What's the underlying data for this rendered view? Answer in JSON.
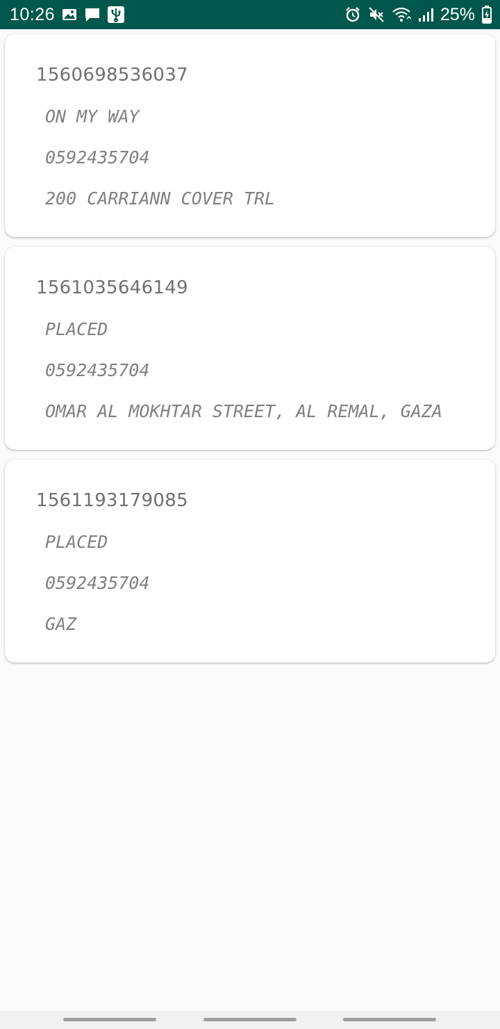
{
  "status_bar": {
    "time": "10:26",
    "battery": "25%",
    "left_icons": [
      "image-icon",
      "message-icon",
      "usb-icon"
    ],
    "right_icons": [
      "alarm-icon",
      "mute-icon",
      "wifi-icon",
      "signal-icon",
      "battery-charging-icon"
    ],
    "background": "#00574b"
  },
  "orders": [
    {
      "id": "1560698536037",
      "status": "ON MY WAY",
      "phone": "0592435704",
      "address": "200 CARRIANN COVER TRL"
    },
    {
      "id": "1561035646149",
      "status": "PLACED",
      "phone": "0592435704",
      "address": "OMAR AL MOKHTAR STREET, AL REMAL, GAZA"
    },
    {
      "id": "1561193179085",
      "status": "PLACED",
      "phone": "0592435704",
      "address": "GAZ"
    }
  ],
  "nav_bar": {
    "items": [
      "recent-apps-button",
      "home-button",
      "back-button"
    ]
  }
}
